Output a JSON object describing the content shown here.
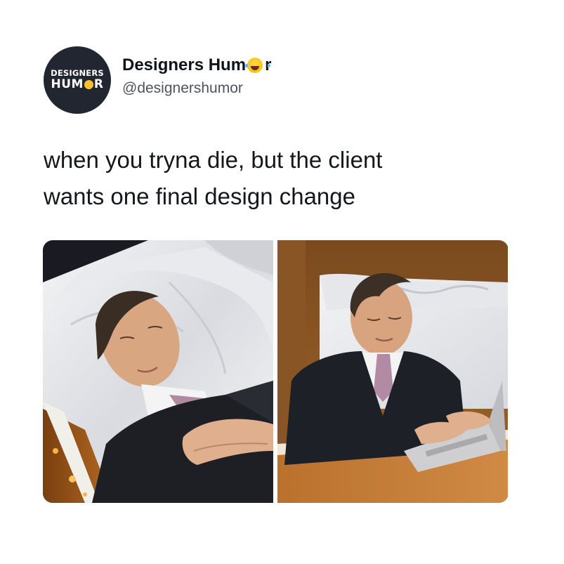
{
  "post": {
    "author": {
      "avatar_line1": "DESIGNERS",
      "avatar_line2_prefix": "HUM",
      "avatar_line2_suffix": "R",
      "display_name_prefix": "Designers Hum",
      "display_name_suffix": "r",
      "emoji_icon": "laughing-crying-face-icon",
      "handle": "@designershumor"
    },
    "text_lines": [
      "when you tryna die, but the client",
      "wants one final design change"
    ],
    "media": {
      "left_image": "man-resting-in-coffin",
      "right_image": "man-in-coffin-typing-on-laptop"
    }
  },
  "colors": {
    "avatar_bg": "#222630",
    "text": "#14181c",
    "handle": "#4a5560"
  }
}
